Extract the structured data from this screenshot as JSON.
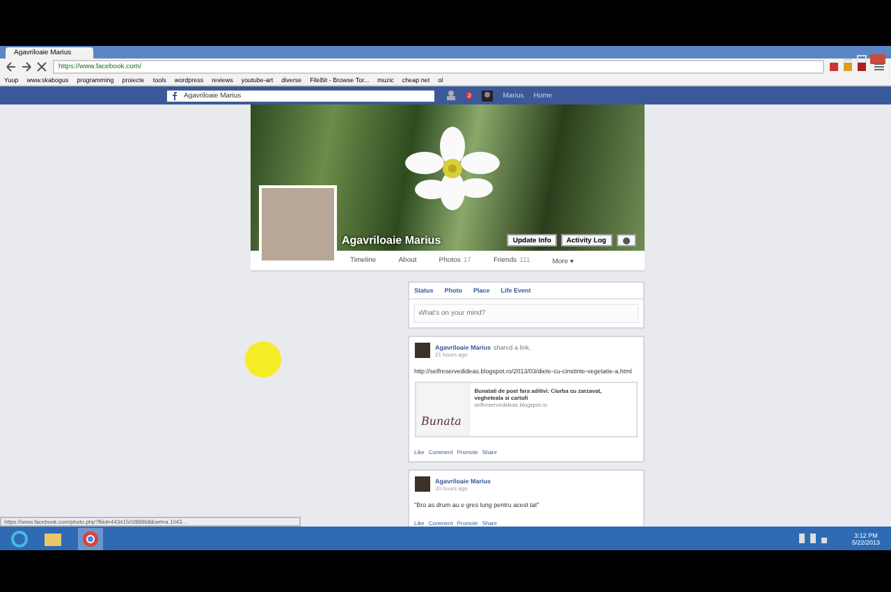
{
  "browser": {
    "tab_title": "Agavriloaie Marius",
    "url": "https://www.facebook.com/",
    "bookmarks": [
      "Yuup",
      "www.skabogus",
      "programming",
      "proiecte",
      "tools",
      "wordpress",
      "reviews",
      "youtube-art",
      "diverse",
      "FileBit - Browse Tor...",
      "muzic",
      "cheap net",
      "ol"
    ]
  },
  "facebook_bar": {
    "search": "Agavriloaie Marius",
    "user": "Marius",
    "home": "Home",
    "notifications": "2"
  },
  "profile": {
    "name": "Agavriloaie Marius",
    "buttons": [
      "Update Info",
      "Activity Log"
    ],
    "tabs": [
      {
        "label": "Timeline"
      },
      {
        "label": "About"
      },
      {
        "label": "Photos",
        "count": "17"
      },
      {
        "label": "Friends",
        "count": "111"
      },
      {
        "label": "More ▾"
      }
    ]
  },
  "composer": {
    "actions": [
      "Status",
      "Photo",
      "Place",
      "Life Event"
    ],
    "placeholder": "What's on your mind?"
  },
  "posts": [
    {
      "author": "Agavriloaie Marius",
      "activity": "shared a link.",
      "time": "21 hours ago",
      "text": "http://selfreservedideas.blogspot.ro/2013/03/diete-cu-cinstinte-vegetatie-a.html",
      "link": {
        "preview_text": "Bunata",
        "title": "Bunatati de post fara aditivi: Ciorba cu zarzavat, vegheteala si cartofi",
        "domain": "selfreservedideas.blogspot.ro"
      },
      "actions": [
        "Like",
        "Comment",
        "Promote",
        "Share"
      ]
    },
    {
      "author": "Agavriloaie Marius",
      "time": "20 hours ago",
      "text": "\"Bro as drum au e gres lung pentru acest tat\"",
      "actions": [
        "Like",
        "Comment",
        "Promote",
        "Share"
      ]
    }
  ],
  "status_url": "https://www.facebook.com/photo.php?fbid=4434150288968&set=a.1043...",
  "taskbar": {
    "time": "3:12 PM",
    "date": "5/22/2013"
  }
}
